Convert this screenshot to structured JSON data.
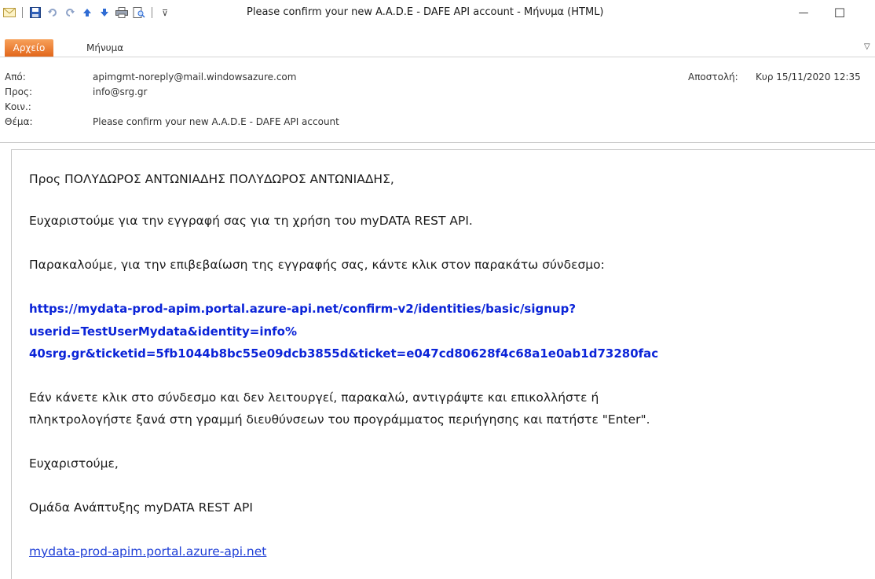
{
  "window": {
    "title": "Please confirm your new A.A.D.E - DAFE API account  -  Μήνυμα (HTML)",
    "minimize_glyph": "—",
    "maximize_glyph": "☐"
  },
  "qat": {
    "icons": [
      "mail-icon",
      "save-icon",
      "undo-icon",
      "redo-icon",
      "up-arrow-icon",
      "down-arrow-icon",
      "print-icon",
      "print-preview-icon",
      "customize-qat-icon"
    ],
    "customize_glyph": "⊽"
  },
  "ribbon": {
    "file_tab": "Αρχείο",
    "message_tab": "Μήνυμα",
    "collapse_glyph": "▽"
  },
  "header": {
    "from_label": "Από:",
    "from_value": "apimgmt-noreply@mail.windowsazure.com",
    "to_label": "Προς:",
    "to_value": "info@srg.gr",
    "cc_label": "Κοιν.:",
    "cc_value": "",
    "subject_label": "Θέμα:",
    "subject_value": "Please confirm your new A.A.D.E - DAFE API account",
    "sent_label": "Αποστολή:",
    "sent_value": "Κυρ 15/11/2020 12:35"
  },
  "body": {
    "greeting": "Προς ΠΟΛΥΔΩΡΟΣ ΑΝΤΩΝΙΑΔΗΣ ΠΟΛΥΔΩΡΟΣ ΑΝΤΩΝΙΑΔΗΣ,",
    "thanks_registration": "Ευχαριστούμε για την εγγραφή σας για τη χρήση του myDATA REST API.",
    "instruction": "Παρακαλούμε, για την επιβεβαίωση της εγγραφής σας, κάντε κλικ στον παρακάτω σύνδεσμο:",
    "confirm_link_line1": "https://mydata-prod-apim.portal.azure-api.net/confirm-v2/identities/basic/signup?",
    "confirm_link_line2": "userid=TestUserMydata&identity=info%",
    "confirm_link_line3": "40srg.gr&ticketid=5fb1044b8bc55e09dcb3855d&ticket=e047cd80628f4c68a1e0ab1d73280fac",
    "fallback_line1": "Εάν κάνετε κλικ στο σύνδεσμο και δεν λειτουργεί, παρακαλώ, αντιγράψτε και επικολλήστε ή",
    "fallback_line2": "πληκτρολογήστε ξανά στη γραμμή διευθύνσεων του προγράμματος περιήγησης και πατήστε \"Enter\".",
    "closing": "Ευχαριστούμε,",
    "signature": "Ομάδα Ανάπτυξης myDATA REST API",
    "portal_link": "mydata-prod-apim.portal.azure-api.net"
  },
  "colors": {
    "file_tab": "#e2661b",
    "link_bold": "#0b24d8",
    "link_plain": "#1f3fd6"
  }
}
